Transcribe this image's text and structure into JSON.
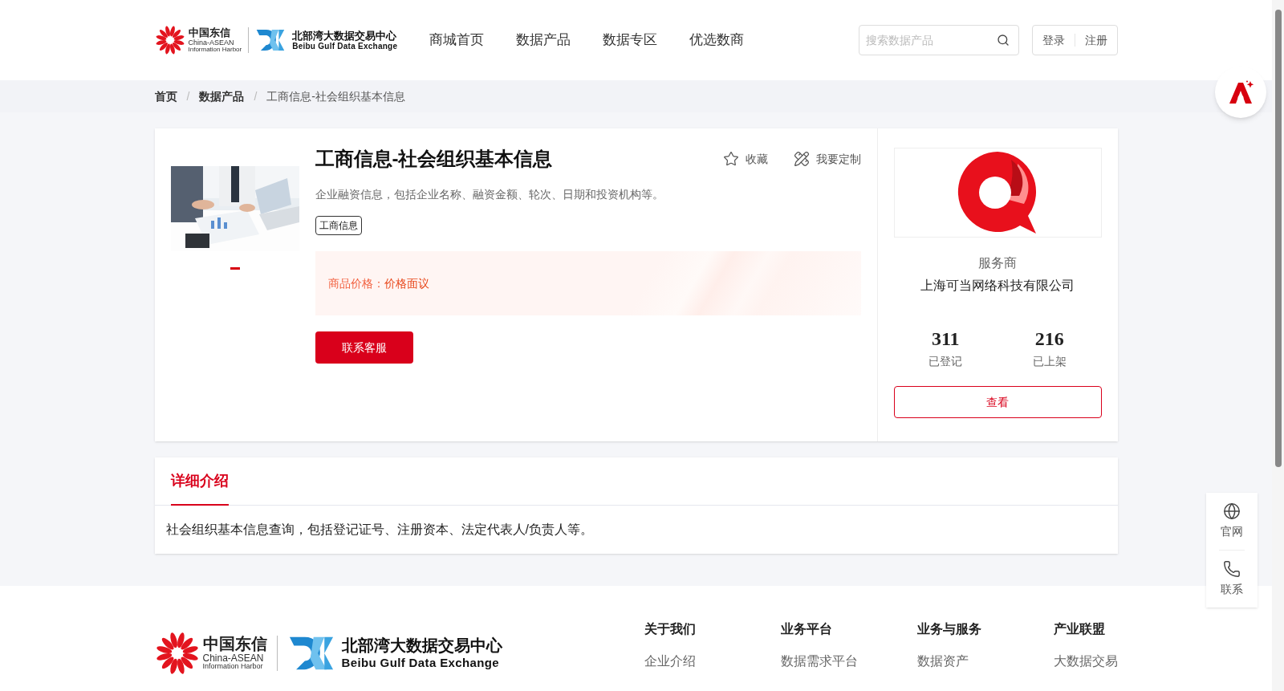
{
  "header": {
    "logo": {
      "cn": "中国东信",
      "en1": "China-ASEAN",
      "en2": "Information Harbor",
      "brand_cn": "北部湾大数据交易中心",
      "brand_en": "Beibu Gulf Data Exchange"
    },
    "nav": [
      {
        "label": "商城首页"
      },
      {
        "label": "数据产品"
      },
      {
        "label": "数据专区"
      },
      {
        "label": "优选数商"
      }
    ],
    "search": {
      "placeholder": "搜索数据产品"
    },
    "auth": [
      "登录",
      "注册"
    ]
  },
  "breadcrumb": {
    "separator": "/",
    "items": [
      {
        "label": "首页",
        "current": false
      },
      {
        "label": "数据产品",
        "current": false
      },
      {
        "label": "工商信息-社会组织基本信息",
        "current": true
      }
    ]
  },
  "product": {
    "title": "工商信息-社会组织基本信息",
    "actions": [
      {
        "label": "收藏",
        "kind": "star"
      },
      {
        "label": "我要定制",
        "kind": "custom"
      }
    ],
    "description": "企业融资信息，包括企业名称、融资金额、轮次、日期和投资机构等。",
    "tags": [
      "工商信息"
    ],
    "price_label": "商品价格：",
    "price": "价格面议",
    "contact_button": "联系客服"
  },
  "provider": {
    "label": "服务商",
    "name": "上海可当网络科技有限公司",
    "stats": [
      {
        "value": "311",
        "label": "已登记"
      },
      {
        "value": "216",
        "label": "已上架"
      }
    ],
    "button": "查看"
  },
  "detail": {
    "tabs": [
      {
        "label": "详细介绍",
        "selected": true
      }
    ],
    "text": "社会组织基本信息查询，包括登记证号、注册资本、法定代表人/负责人等。"
  },
  "side_tools": [
    {
      "label": "官网",
      "kind": "globe"
    },
    {
      "label": "联系",
      "kind": "phone"
    }
  ],
  "footer": {
    "logo": {
      "cn": "中国东信",
      "en1": "China-ASEAN",
      "en2": "Information Harbor",
      "brand_cn": "北部湾大数据交易中心",
      "brand_en": "Beibu Gulf Data Exchange"
    },
    "columns": [
      {
        "title": "关于我们",
        "items": [
          "企业介绍"
        ]
      },
      {
        "title": "业务平台",
        "items": [
          "数据需求平台"
        ]
      },
      {
        "title": "业务与服务",
        "items": [
          "数据资产"
        ]
      },
      {
        "title": "产业联盟",
        "items": [
          "大数据交易"
        ]
      }
    ]
  }
}
